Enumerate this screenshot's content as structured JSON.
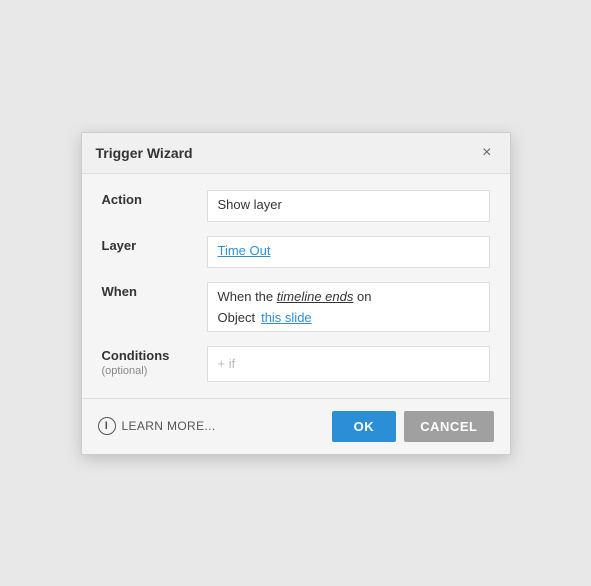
{
  "dialog": {
    "title": "Trigger Wizard",
    "close_label": "×",
    "action_label": "Action",
    "action_value": "Show layer",
    "layer_label": "Layer",
    "layer_value": "Time Out",
    "when_label": "When",
    "when_text_before": "When the ",
    "when_text_highlight": "timeline ends",
    "when_text_after": " on",
    "object_label": "Object",
    "object_value": "this slide",
    "conditions_label": "Conditions",
    "conditions_optional": "(optional)",
    "conditions_placeholder": "+ if",
    "learn_more_label": "LEARN MORE...",
    "ok_label": "OK",
    "cancel_label": "CANCEL"
  }
}
